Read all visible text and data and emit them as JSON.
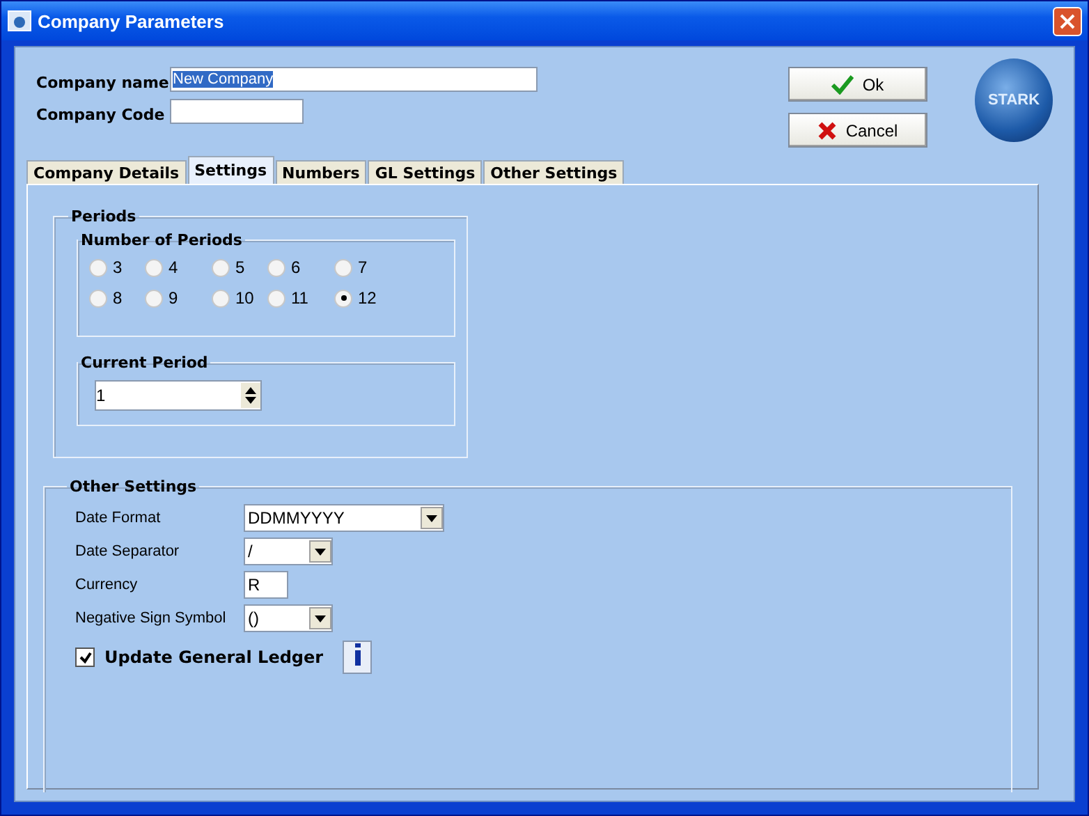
{
  "window": {
    "title": "Company Parameters"
  },
  "company_name": {
    "label": "Company name",
    "value": "New Company"
  },
  "company_code": {
    "label": "Company Code"
  },
  "buttons": [
    {
      "kind": "ok",
      "label": "Ok"
    },
    {
      "kind": "cancel",
      "label": "Cancel"
    }
  ],
  "logo": {
    "text": "STARK"
  },
  "tabs": [
    {
      "label": "Company Details",
      "selected": false
    },
    {
      "label": "Settings",
      "selected": true
    },
    {
      "label": "Numbers",
      "selected": false
    },
    {
      "label": "GL Settings",
      "selected": false
    },
    {
      "label": "Other Settings",
      "selected": false
    }
  ],
  "periods": {
    "title": "Periods",
    "number_of_periods": {
      "title": "Number of Periods",
      "options": [
        {
          "label": "3",
          "selected": false
        },
        {
          "label": "4",
          "selected": false
        },
        {
          "label": "5",
          "selected": false
        },
        {
          "label": "6",
          "selected": false
        },
        {
          "label": "7",
          "selected": false
        },
        {
          "label": "8",
          "selected": false
        },
        {
          "label": "9",
          "selected": false
        },
        {
          "label": "10",
          "selected": false
        },
        {
          "label": "11",
          "selected": false
        },
        {
          "label": "12",
          "selected": true
        }
      ]
    },
    "current_period": {
      "title": "Current Period",
      "value": "1"
    }
  },
  "other_settings": {
    "title": "Other Settings",
    "fields": [
      {
        "kind": "wide_dropdown",
        "label": "Date Format",
        "value": "DDMMYYYY"
      },
      {
        "kind": "dropdown",
        "label": "Date Separator",
        "value": "/"
      },
      {
        "kind": "text",
        "label": "Currency",
        "value": "R"
      },
      {
        "kind": "dropdown",
        "label": "Negative Sign Symbol",
        "value": "()"
      }
    ],
    "update_gl": {
      "label": "Update General Ledger",
      "checked": true
    }
  }
}
